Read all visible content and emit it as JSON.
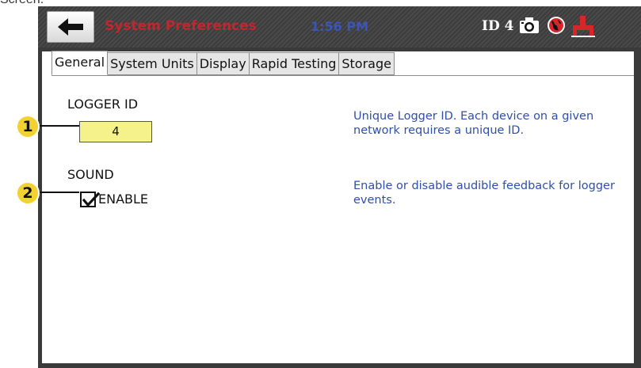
{
  "caption_fragment": "Screen.",
  "header": {
    "title": "System Preferences",
    "time": "1:56 PM",
    "device_id": "ID 4"
  },
  "icons": {
    "back": "back-arrow-icon",
    "camera": "camera-icon",
    "network": "globe-icon",
    "connection": "plug-icon"
  },
  "tabs": [
    {
      "label": "General",
      "active": true
    },
    {
      "label": "System Units",
      "active": false
    },
    {
      "label": "Display",
      "active": false
    },
    {
      "label": "Rapid Testing",
      "active": false
    },
    {
      "label": "Storage",
      "active": false
    }
  ],
  "logger_id": {
    "label": "LOGGER ID",
    "value": "4",
    "help": "Unique Logger ID.  Each device on a given network requires a unique ID."
  },
  "sound": {
    "label": "SOUND",
    "checkbox_label": "ENABLE",
    "checked": true,
    "help": "Enable or disable audible feedback for logger events."
  },
  "callouts": [
    "1",
    "2"
  ],
  "colors": {
    "title": "#c2262e",
    "time": "#3b55b9",
    "help_text": "#2f4fa8",
    "id_field": "#f6f28b",
    "callout": "#f2d233"
  }
}
